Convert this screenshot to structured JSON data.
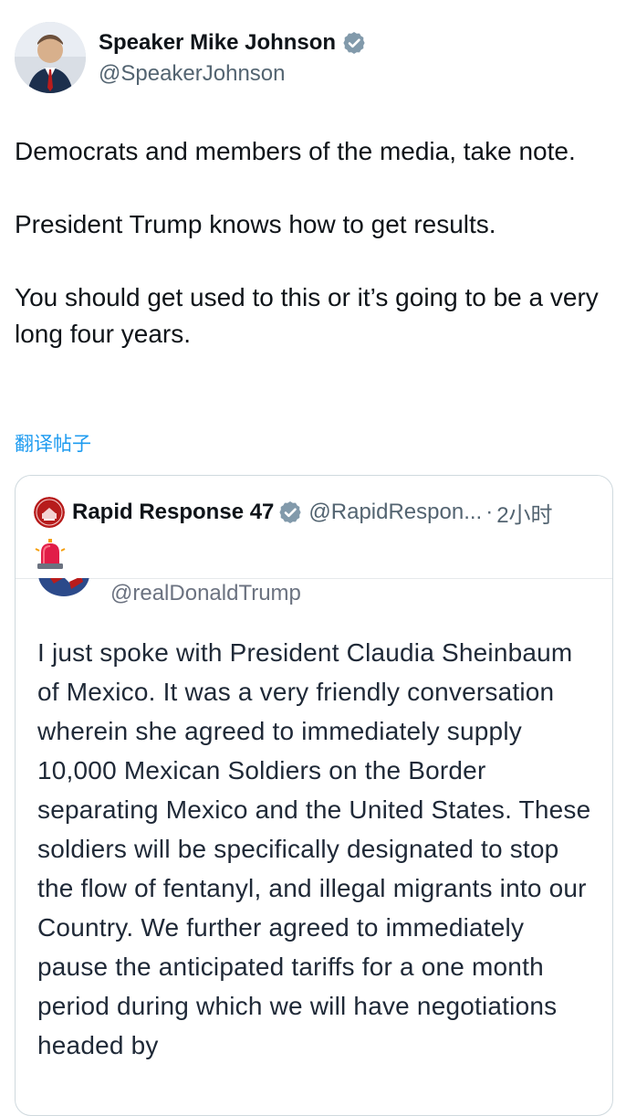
{
  "author": {
    "display_name": "Speaker Mike Johnson",
    "handle": "@SpeakerJohnson",
    "verified_icon": "verified-badge-icon"
  },
  "tweet": {
    "paragraphs": [
      "Democrats and members of the media, take note.",
      "President Trump knows how to get results.",
      "You should get used to this or it’s going to be a very long four years."
    ],
    "translate_label": "翻译帖子"
  },
  "quote": {
    "display_name": "Rapid Response 47",
    "handle": "@RapidRespon...",
    "separator": "·",
    "time": "2小时",
    "emoji_icon": "siren-icon",
    "inner": {
      "handle": "@realDonaldTrump",
      "text": "I just spoke with President Claudia Sheinbaum of Mexico. It was a very friendly conversation wherein she agreed to immediately supply 10,000 Mexican Soldiers on the Border separating Mexico and the United States. These soldiers will be specifically designated to stop the flow of fentanyl, and illegal migrants into our Country. We further agreed to immediately pause the anticipated tariffs for a one month period during which we will have negotiations headed by"
    }
  },
  "colors": {
    "text": "#0f1419",
    "muted": "#536471",
    "link": "#1d9bf0",
    "verified": "#829aab",
    "border": "#cfd9de"
  }
}
